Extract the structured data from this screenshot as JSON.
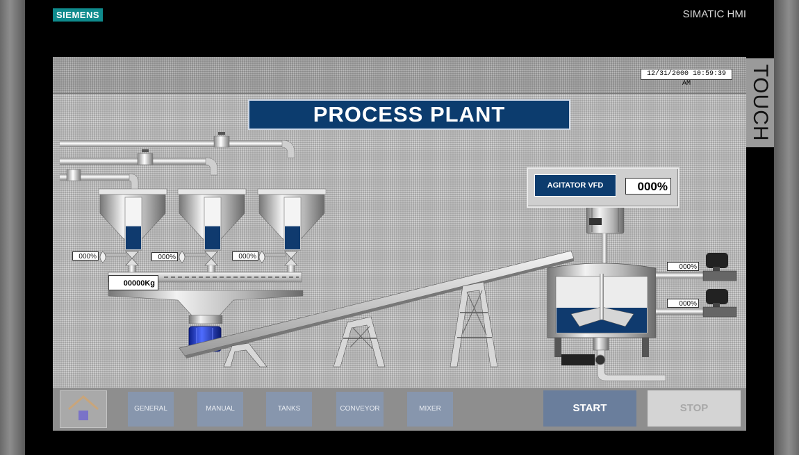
{
  "device": {
    "brand": "SIEMENS",
    "model": "SIMATIC HMI",
    "side_label": "TOUCH"
  },
  "screen": {
    "datetime": "12/31/2000 10:59:39 AM",
    "title": "PROCESS PLANT",
    "agitator": {
      "label": "AGITATOR VFD",
      "value": "000%"
    },
    "valve_readouts": [
      "000%",
      "000%",
      "000%"
    ],
    "weight": "00000Kg",
    "inlet_readouts": [
      "000%",
      "000%"
    ],
    "hopper_levels": [
      0.45,
      0.45,
      0.45
    ],
    "mixer_level": 0.45
  },
  "nav": {
    "home_icon": "home-icon",
    "buttons": [
      "GENERAL",
      "MANUAL",
      "TANKS",
      "CONVEYOR",
      "MIXER"
    ],
    "start": "START",
    "stop": "STOP"
  },
  "colors": {
    "title_bg": "#0c3c6e",
    "fluid": "#0f3a6e",
    "brand": "#0f8b8d"
  }
}
